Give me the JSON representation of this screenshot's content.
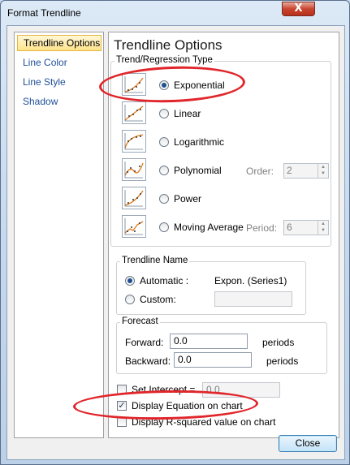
{
  "window": {
    "title": "Format Trendline",
    "close_glyph": "X",
    "close_icon": "close-icon"
  },
  "nav": {
    "items": [
      {
        "label": "Trendline Options",
        "selected": true
      },
      {
        "label": "Line Color",
        "selected": false
      },
      {
        "label": "Line Style",
        "selected": false
      },
      {
        "label": "Shadow",
        "selected": false
      }
    ]
  },
  "panel": {
    "title": "Trendline Options",
    "type_group": {
      "label": "Trend/Regression Type",
      "options": [
        {
          "label": "Exponential",
          "key": "x",
          "selected": true,
          "icon": "exponential-trend-icon"
        },
        {
          "label": "Linear",
          "key": "L",
          "selected": false,
          "icon": "linear-trend-icon"
        },
        {
          "label": "Logarithmic",
          "key": "o",
          "selected": false,
          "icon": "logarithmic-trend-icon"
        },
        {
          "label": "Polynomial",
          "key": "P",
          "selected": false,
          "icon": "polynomial-trend-icon"
        },
        {
          "label": "Power",
          "key": "w",
          "selected": false,
          "icon": "power-trend-icon"
        },
        {
          "label": "Moving Average",
          "key": "M",
          "selected": false,
          "icon": "moving-average-trend-icon"
        }
      ],
      "order_label": "Order:",
      "order_value": "2",
      "period_label": "Period:",
      "period_value": "6"
    },
    "name_group": {
      "label": "Trendline Name",
      "automatic_label": "Automatic :",
      "automatic_value": "Expon. (Series1)",
      "automatic_selected": true,
      "custom_label": "Custom:",
      "custom_value": ""
    },
    "forecast_group": {
      "label": "Forecast",
      "forward_label": "Forward:",
      "forward_value": "0.0",
      "forward_unit": "periods",
      "backward_label": "Backward:",
      "backward_value": "0.0",
      "backward_unit": "periods"
    },
    "set_intercept": {
      "label": "Set Intercept =",
      "checked": false,
      "value": "0.0"
    },
    "display_equation": {
      "label": "Display Equation on chart",
      "checked": true
    },
    "display_r_squared": {
      "label": "Display R-squared value on chart",
      "checked": false
    }
  },
  "footer": {
    "close_label": "Close"
  },
  "annotation_color": "#e0262b",
  "accent_color": "#1d4f8e"
}
